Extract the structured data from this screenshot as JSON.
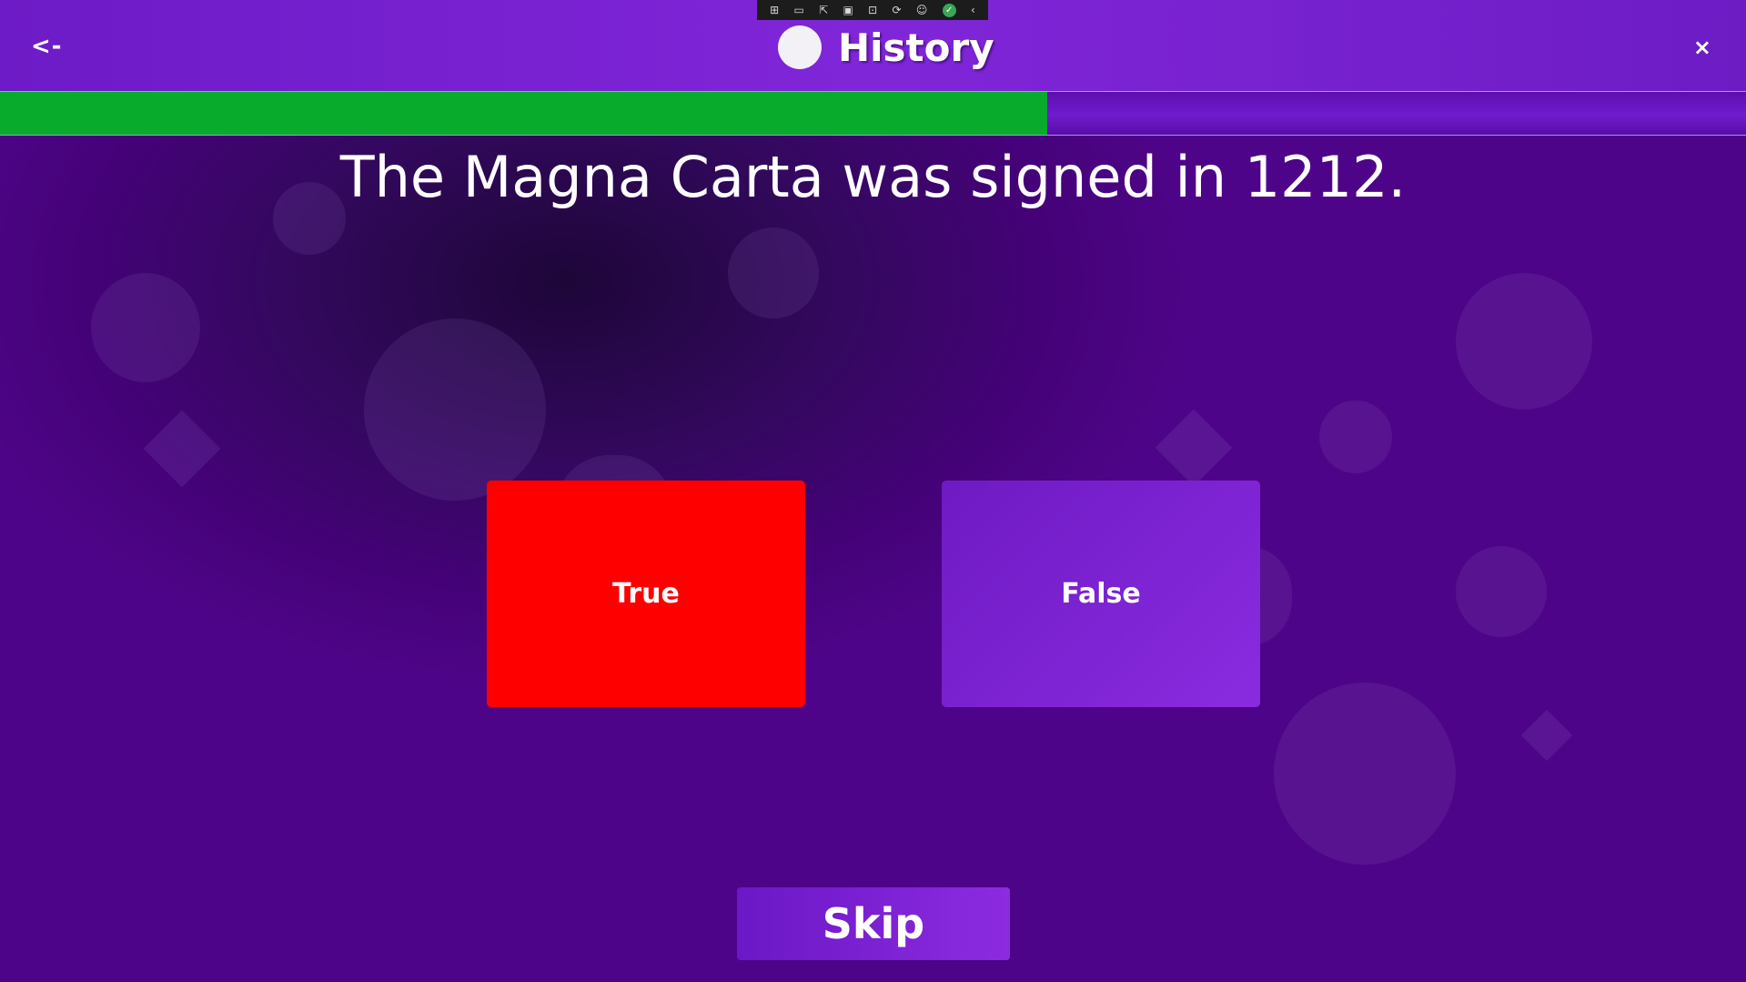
{
  "header": {
    "back_label": "<-",
    "title": "History",
    "close_label": "×"
  },
  "toolbar": {
    "icons": [
      "live-visual-tree-icon",
      "record-icon",
      "select-element-icon",
      "display-layout-adorners-icon",
      "track-focus-icon",
      "hot-reload-icon",
      "accessibility-icon",
      "check-icon",
      "collapse-chevron-icon"
    ]
  },
  "progress": {
    "fraction": 0.6
  },
  "question": {
    "text": "The Magna Carta was signed in 1212."
  },
  "answers": [
    {
      "label": "True",
      "color": "#ff0000"
    },
    {
      "label": "False",
      "color": "#7b22d3"
    }
  ],
  "skip_label": "Skip",
  "colors": {
    "header": "#7a22d3",
    "progress_fill": "#08ab2c",
    "background": "#440277"
  }
}
